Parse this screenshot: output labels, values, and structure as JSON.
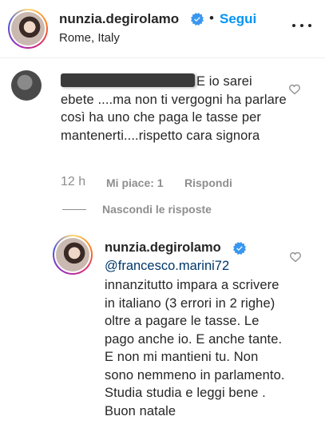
{
  "header": {
    "username": "nunzia.degirolamo",
    "separator": "•",
    "follow_label": "Segui",
    "location": "Rome, Italy"
  },
  "comment": {
    "text": "E io sarei ebete ....ma non ti vergogni ha parlare così ha uno che paga le tasse per mantenerti....rispetto cara signora",
    "time": "12 h",
    "likes": "Mi piace: 1",
    "reply_label": "Rispondi"
  },
  "hide_replies_label": "Nascondi le risposte",
  "reply": {
    "username": "nunzia.degirolamo",
    "mention": "@francesco.marini72",
    "text": "innanzitutto impara a scrivere in italiano (3 errori in 2 righe) oltre a pagare le tasse. Le pago anche io. E anche tante. E non mi mantieni tu. Non sono nemmeno in parlamento. Studia studia e leggi bene . Buon natale"
  },
  "colors": {
    "accent": "#0095f6",
    "verified": "#3897f0",
    "mention": "#00376b",
    "secondary_text": "#8e8e8e"
  },
  "icons": [
    "verified-badge-icon",
    "more-options-icon",
    "heart-icon"
  ]
}
